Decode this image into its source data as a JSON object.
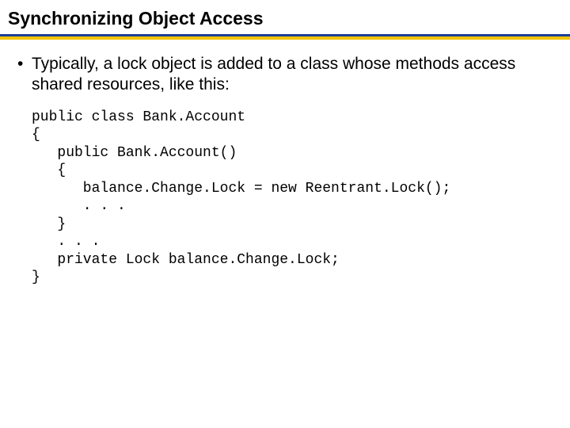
{
  "title": "Synchronizing Object Access",
  "bullet1": "Typically, a lock object is added to a class whose methods access shared resources, like this:",
  "code": "public class Bank.Account\n{\n   public Bank.Account()\n   {\n      balance.Change.Lock = new Reentrant.Lock();\n      . . .\n   }\n   . . .\n   private Lock balance.Change.Lock;\n}"
}
